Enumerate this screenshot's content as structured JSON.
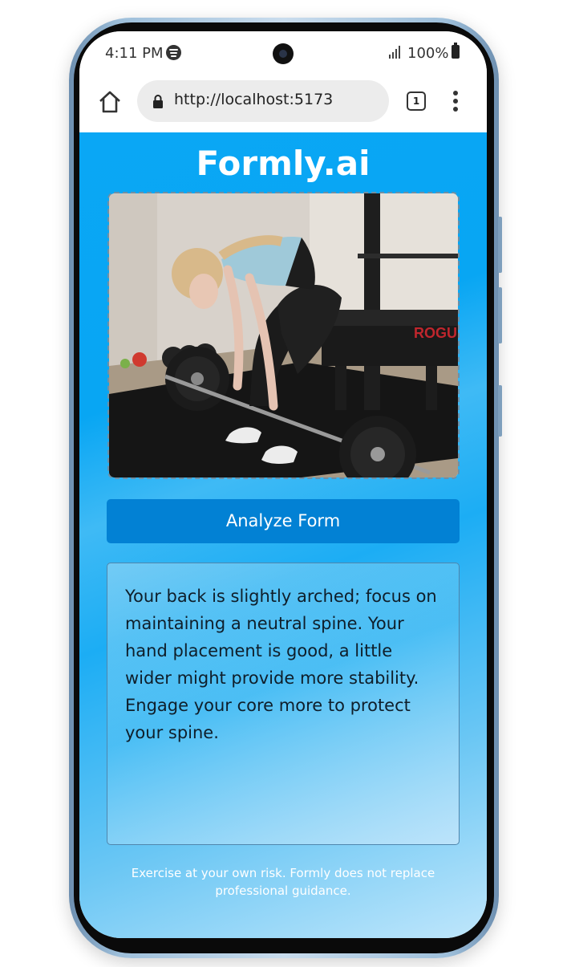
{
  "status_bar": {
    "time": "4:11 PM",
    "battery": "100%"
  },
  "browser": {
    "url": "http://localhost:5173",
    "tab_count": "1"
  },
  "app": {
    "title": "Formly.ai",
    "photo": {
      "brand_label": "ROGUE"
    },
    "analyze_label": "Analyze Form",
    "result_text": "Your back is slightly arched; focus on maintaining a neutral spine. Your hand placement is good, a little wider might provide more stability. Engage your core more to protect your spine.",
    "disclaimer": "Exercise at your own risk. Formly does not replace professional guidance."
  },
  "icons": {
    "home": "home-icon",
    "lock": "lock-icon",
    "tabs": "tabs-icon",
    "more": "more-vertical-icon",
    "spotify": "spotify-icon",
    "signal": "signal-icon",
    "battery": "battery-icon"
  }
}
